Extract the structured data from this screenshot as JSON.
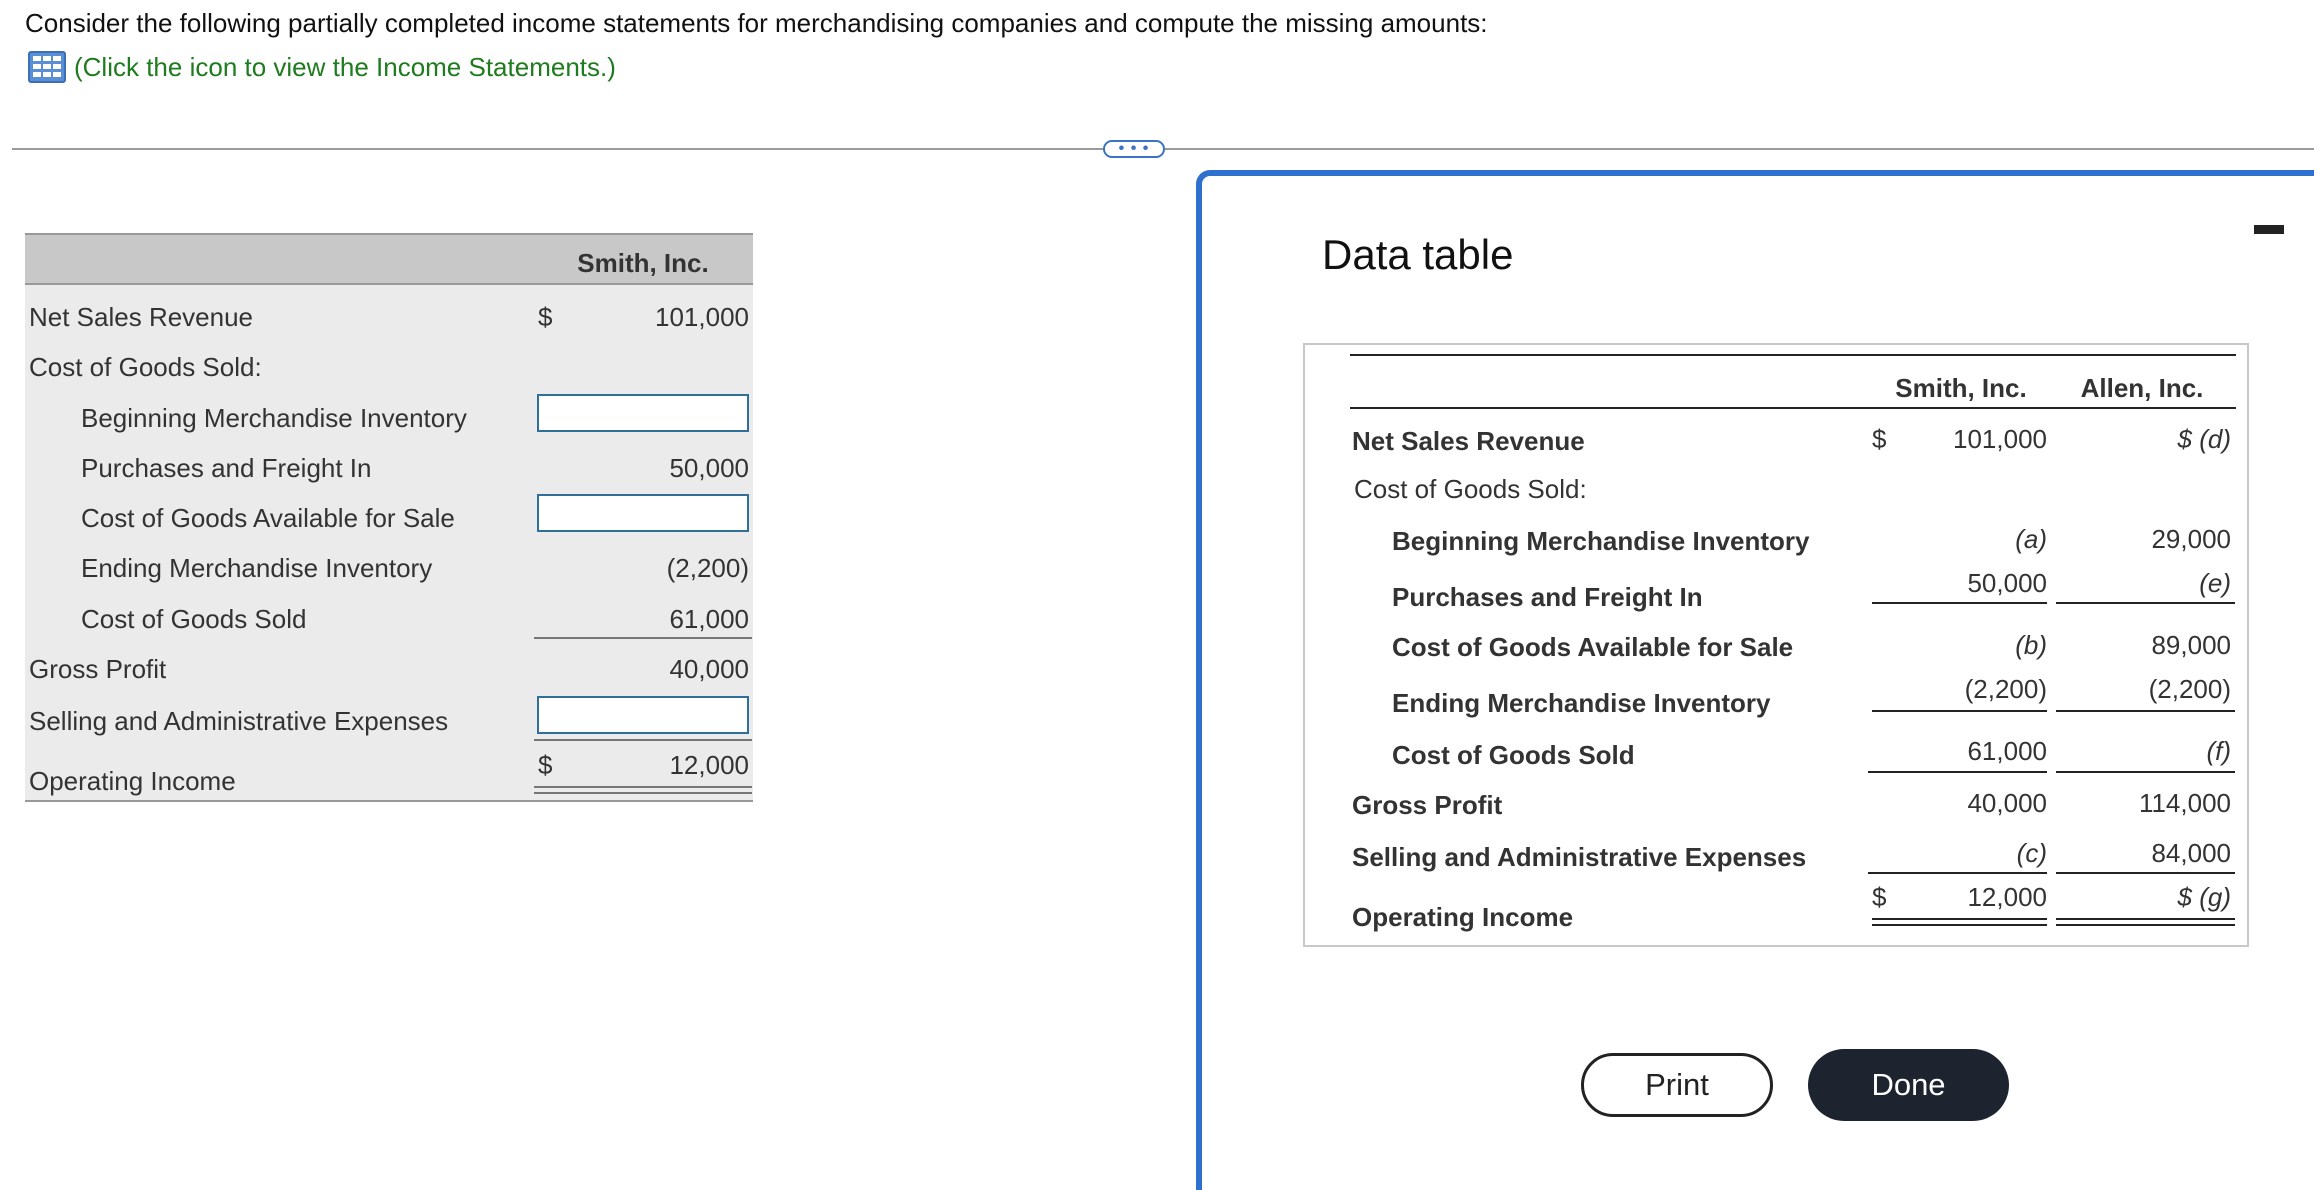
{
  "question": {
    "prompt": "Consider the following partially completed income statements for merchandising companies and compute the missing amounts:",
    "link_text": "(Click the icon to view the Income Statements.)",
    "link_icon": "table-grid-icon",
    "link_color": "#1e7b1e"
  },
  "expand_button": {
    "label": "• • •"
  },
  "worksheet": {
    "column_header": "Smith, Inc.",
    "currency_symbol": "$",
    "rows": {
      "net_sales": {
        "label": "Net Sales Revenue",
        "value": "101,000"
      },
      "cogs_heading": {
        "label": "Cost of Goods Sold:"
      },
      "beginning_inventory": {
        "label": "Beginning Merchandise Inventory",
        "input_value": ""
      },
      "purchases": {
        "label": "Purchases and Freight In",
        "value": "50,000"
      },
      "available": {
        "label": "Cost of Goods Available for Sale",
        "input_value": ""
      },
      "ending_inventory": {
        "label": "Ending Merchandise Inventory",
        "value": "(2,200)"
      },
      "cogs": {
        "label": "Cost of Goods Sold",
        "value": "61,000"
      },
      "gross_profit": {
        "label": "Gross Profit",
        "value": "40,000"
      },
      "sga": {
        "label": "Selling and Administrative Expenses",
        "input_value": ""
      },
      "operating_income": {
        "label": "Operating Income",
        "value": "12,000"
      }
    }
  },
  "modal": {
    "title": "Data table",
    "accent_color": "#2f6fcd",
    "columns": [
      "Smith, Inc.",
      "Allen, Inc."
    ],
    "currency_symbol": "$",
    "rows": {
      "net_sales": {
        "label": "Net Sales Revenue",
        "smith": "101,000",
        "allen": "$ (d)"
      },
      "cogs_heading": {
        "label": "Cost of Goods Sold:"
      },
      "beginning_inventory": {
        "label": "Beginning Merchandise Inventory",
        "smith": "(a)",
        "allen": "29,000"
      },
      "purchases": {
        "label": "Purchases and Freight In",
        "smith": "50,000",
        "allen": "(e)"
      },
      "available": {
        "label": "Cost of Goods Available for Sale",
        "smith": "(b)",
        "allen": "89,000"
      },
      "ending_inventory": {
        "label": "Ending Merchandise Inventory",
        "smith": "(2,200)",
        "allen": "(2,200)"
      },
      "cogs": {
        "label": "Cost of Goods Sold",
        "smith": "61,000",
        "allen": "(f)"
      },
      "gross_profit": {
        "label": "Gross Profit",
        "smith": "40,000",
        "allen": "114,000"
      },
      "sga": {
        "label": "Selling and Administrative Expenses",
        "smith": "(c)",
        "allen": "84,000"
      },
      "operating_income": {
        "label": "Operating Income",
        "smith": "12,000",
        "allen": "$ (g)"
      }
    },
    "print_label": "Print",
    "done_label": "Done",
    "done_color": "#1d2430"
  }
}
